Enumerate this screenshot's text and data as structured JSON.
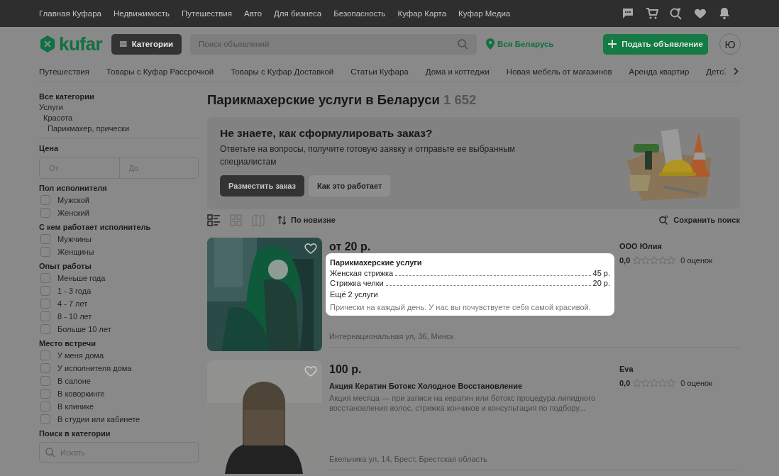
{
  "top_links": [
    "Главная Куфара",
    "Недвижимость",
    "Путешествия",
    "Авто",
    "Для бизнеса",
    "Безопасность",
    "Куфар Карта",
    "Куфар Медиа"
  ],
  "header": {
    "logo": "kufar",
    "categories_button": "Категории",
    "search": {
      "placeholder": "Поиск объявлений"
    },
    "location": "Вся Беларусь",
    "post_button": "Подать объявление",
    "avatar": "Ю"
  },
  "category_nav": [
    "Путешествия",
    "Товары с Куфар Рассрочкой",
    "Товары с Куфар Доставкой",
    "Статьи Куфара",
    "Дома и коттеджи",
    "Новая мебель от магазинов",
    "Аренда квартир",
    "Детс"
  ],
  "sidebar": {
    "all_categories": "Все категории",
    "tree": [
      {
        "label": "Услуги",
        "children": [
          {
            "label": "Красота",
            "children": [
              {
                "label": "Парикмахер, прически"
              }
            ]
          }
        ]
      }
    ],
    "price": {
      "title": "Цена",
      "from_placeholder": "От",
      "to_placeholder": "До"
    },
    "filters": [
      {
        "title": "Пол исполнителя",
        "options": [
          {
            "label": "Мужской",
            "checked": false
          },
          {
            "label": "Женский",
            "checked": false
          }
        ]
      },
      {
        "title": "С кем работает исполнитель",
        "options": [
          {
            "label": "Мужчины",
            "checked": false
          },
          {
            "label": "Женщины",
            "checked": false
          }
        ]
      },
      {
        "title": "Опыт работы",
        "options": [
          {
            "label": "Меньше года",
            "checked": false
          },
          {
            "label": "1 - 3 года",
            "checked": false
          },
          {
            "label": "4 - 7 лет",
            "checked": false
          },
          {
            "label": "8 - 10 лет",
            "checked": false
          },
          {
            "label": "Больше 10 лет",
            "checked": false
          }
        ]
      },
      {
        "title": "Место встречи",
        "options": [
          {
            "label": "У меня дома",
            "checked": false
          },
          {
            "label": "У исполнителя дома",
            "checked": false
          },
          {
            "label": "В салоне",
            "checked": false
          },
          {
            "label": "В коворкинге",
            "checked": false
          },
          {
            "label": "В клинике",
            "checked": false
          },
          {
            "label": "В студии или кабинете",
            "checked": false
          }
        ]
      }
    ],
    "category_search": {
      "title": "Поиск в категории",
      "placeholder": "Искать"
    }
  },
  "main": {
    "title": "Парикмахерские услуги в Беларуси",
    "count": "1 652",
    "banner": {
      "title": "Не знаете, как сформулировать заказ?",
      "text": "Ответьте на вопросы, получите готовую заявку и отправьте ее выбранным специалистам",
      "primary_button": "Разместить заказ",
      "secondary_button": "Как это работает"
    },
    "views": [
      {
        "kind": "list",
        "selected": true
      },
      {
        "kind": "grid",
        "selected": false
      },
      {
        "kind": "map",
        "selected": false
      }
    ],
    "sort": "По новизне",
    "save_search": "Сохранить поиск",
    "listings": [
      {
        "price": "от 20 р.",
        "seller": "ООО Юлия",
        "rating": "0,0",
        "stars": 0,
        "reviews": "0 оценок",
        "address": "Интернациональная ул, 36, Минск",
        "popup": {
          "title": "Парикмахерские услуги",
          "services": [
            {
              "name": "Женская стрижка",
              "price": "45 р."
            },
            {
              "name": "Стрижка челки",
              "price": "20 р."
            }
          ],
          "more": "Ещё 2 услуги",
          "description": "Прически на каждый день. У нас вы почувствуете себя самой красивой."
        }
      },
      {
        "price": "100 р.",
        "seller": "Eva",
        "rating": "0,0",
        "stars": 0,
        "reviews": "0 оценок",
        "address": "Екельчика ул, 14, Брест, Брестская область",
        "title": "Акция Кератин Ботокс Холодное Восстановление",
        "description": "Акция месяца — при записи на кератин или ботокс процедура липидного восстановления волос, стрижка кончиков и консультация по подбору..."
      }
    ]
  }
}
